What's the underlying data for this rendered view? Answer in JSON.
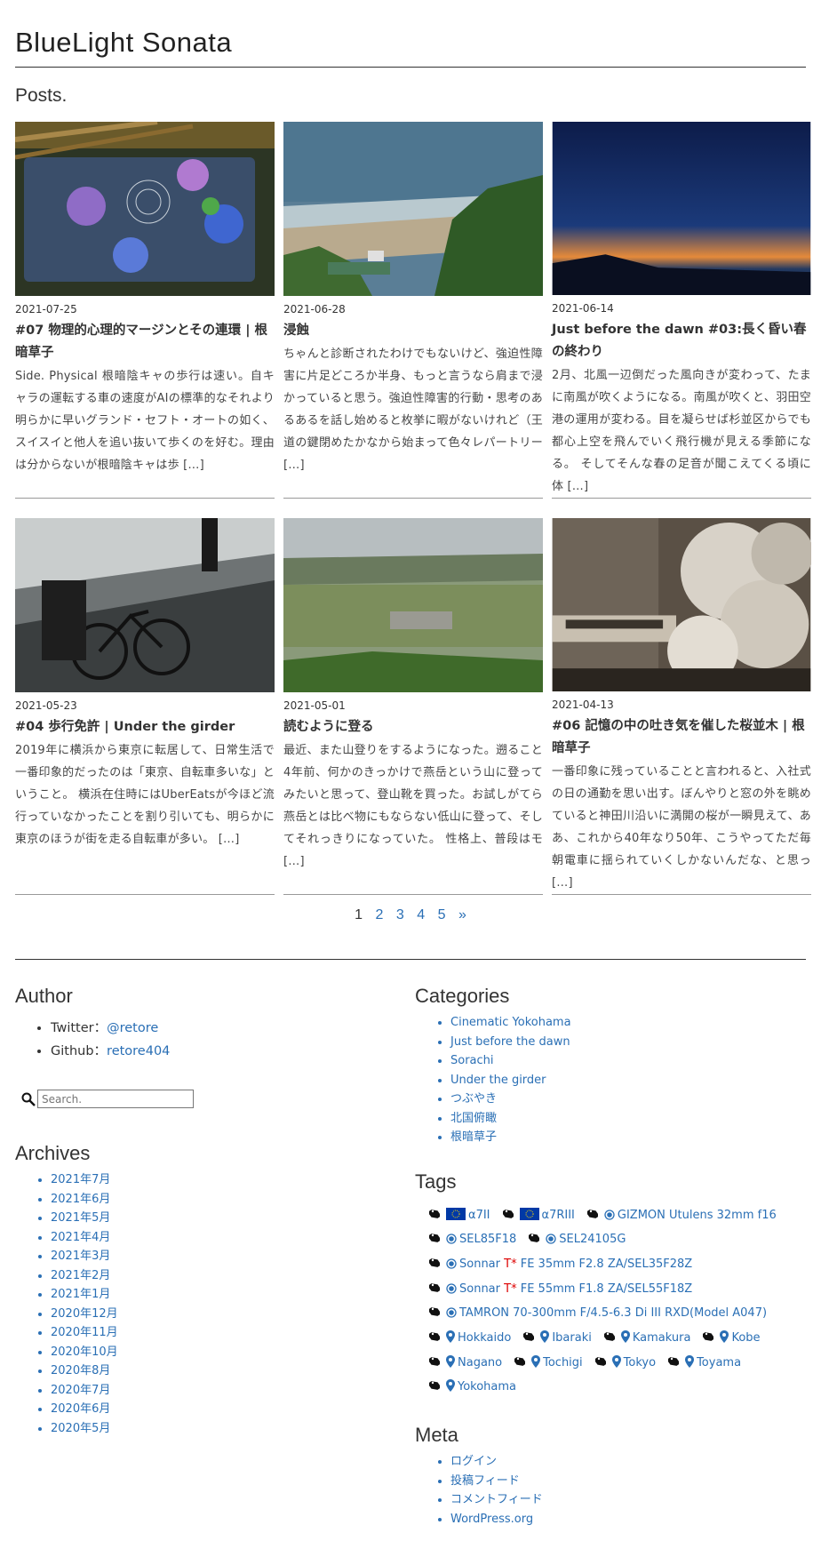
{
  "site_title": "BlueLight Sonata",
  "posts_heading": "Posts.",
  "posts": [
    {
      "date": "2021-07-25",
      "title": "#07 物理的心理的マージンとその連環 | 根暗草子",
      "excerpt": "Side. Physical 根暗陰キャの歩行は速い。自キャラの運転する車の速度がAIの標準的なそれより明らかに早いグランド・セフト・オートの如く、スイスイと他人を追い抜いて歩くのを好む。理由は分からないが根暗陰キャは歩 […]"
    },
    {
      "date": "2021-06-28",
      "title": "浸蝕",
      "excerpt": "ちゃんと診断されたわけでもないけど、強迫性障害に片足どころか半身、もっと言うなら肩まで浸かっていると思う。強迫性障害的行動・思考のあるあるを話し始めると枚挙に暇がないけれど（王道の鍵閉めたかなから始まって色々レパートリー […]"
    },
    {
      "date": "2021-06-14",
      "title": "Just before the dawn #03:長く昏い春の終わり",
      "excerpt": "2月、北風一辺倒だった風向きが変わって、たまに南風が吹くようになる。南風が吹くと、羽田空港の運用が変わる。目を凝らせば杉並区からでも都心上空を飛んでいく飛行機が見える季節になる。 そしてそんな春の足音が聞こえてくる頃に体 […]"
    },
    {
      "date": "2021-05-23",
      "title": "#04 歩行免許 | Under the girder",
      "excerpt": "2019年に横浜から東京に転居して、日常生活で一番印象的だったのは「東京、自転車多いな」ということ。 横浜在住時にはUberEatsが今ほど流行っていなかったことを割り引いても、明らかに東京のほうが街を走る自転車が多い。 […]"
    },
    {
      "date": "2021-05-01",
      "title": "読むように登る",
      "excerpt": "最近、また山登りをするようになった。遡ること4年前、何かのきっかけで燕岳という山に登ってみたいと思って、登山靴を買った。お試しがてら燕岳とは比べ物にもならない低山に登って、そしてそれっきりになっていた。 性格上、普段はモ […]"
    },
    {
      "date": "2021-04-13",
      "title": "#06 記憶の中の吐き気を催した桜並木 | 根暗草子",
      "excerpt": "一番印象に残っていることと言われると、入社式の日の通勤を思い出す。ぼんやりと窓の外を眺めていると神田川沿いに満開の桜が一瞬見えて、ああ、これから40年なり50年、こうやってただ毎朝電車に揺られていくしかないんだな、と思っ […]"
    }
  ],
  "pagination": {
    "pages": [
      "1",
      "2",
      "3",
      "4",
      "5"
    ],
    "current": "1",
    "next": "»"
  },
  "author": {
    "title": "Author",
    "twitter_label": "Twitter：",
    "twitter": "@retore",
    "github_label": "Github：",
    "github": "retore404"
  },
  "search": {
    "placeholder": "Search."
  },
  "archives": {
    "title": "Archives",
    "items": [
      "2021年7月",
      "2021年6月",
      "2021年5月",
      "2021年4月",
      "2021年3月",
      "2021年2月",
      "2021年1月",
      "2020年12月",
      "2020年11月",
      "2020年10月",
      "2020年8月",
      "2020年7月",
      "2020年6月",
      "2020年5月"
    ]
  },
  "categories": {
    "title": "Categories",
    "items": [
      "Cinematic Yokohama",
      "Just before the dawn",
      "Sorachi",
      "Under the girder",
      "つぶやき",
      "北国俯瞰",
      "根暗草子"
    ]
  },
  "tags": {
    "title": "Tags",
    "items": [
      {
        "icon": "eu-flag-icon",
        "label": "α7II"
      },
      {
        "icon": "eu-flag-icon",
        "label": "α7RIII"
      },
      {
        "icon": "lens-icon",
        "label": "GIZMON Utulens 32mm f16"
      },
      {
        "icon": "lens-icon",
        "label": "SEL85F18"
      },
      {
        "icon": "lens-icon",
        "label": "SEL24105G"
      },
      {
        "icon": "lens-icon",
        "label": "Sonnar ",
        "mark": "T*",
        "rest": " FE 35mm F2.8 ZA/SEL35F28Z"
      },
      {
        "icon": "lens-icon",
        "label": "Sonnar ",
        "mark": "T*",
        "rest": " FE 55mm F1.8 ZA/SEL55F18Z"
      },
      {
        "icon": "lens-icon",
        "label": "TAMRON 70-300mm F/4.5-6.3 Di III RXD(Model A047)"
      },
      {
        "icon": "map-pin-icon",
        "label": "Hokkaido"
      },
      {
        "icon": "map-pin-icon",
        "label": "Ibaraki"
      },
      {
        "icon": "map-pin-icon",
        "label": "Kamakura"
      },
      {
        "icon": "map-pin-icon",
        "label": "Kobe"
      },
      {
        "icon": "map-pin-icon",
        "label": "Nagano"
      },
      {
        "icon": "map-pin-icon",
        "label": "Tochigi"
      },
      {
        "icon": "map-pin-icon",
        "label": "Tokyo"
      },
      {
        "icon": "map-pin-icon",
        "label": "Toyama"
      },
      {
        "icon": "map-pin-icon",
        "label": "Yokohama"
      }
    ]
  },
  "meta": {
    "title": "Meta",
    "items": [
      "ログイン",
      "投稿フィード",
      "コメントフィード",
      "WordPress.org"
    ]
  },
  "colors": {
    "link": "#2a6fb5",
    "text": "#333333",
    "mark": "#dd0000"
  }
}
